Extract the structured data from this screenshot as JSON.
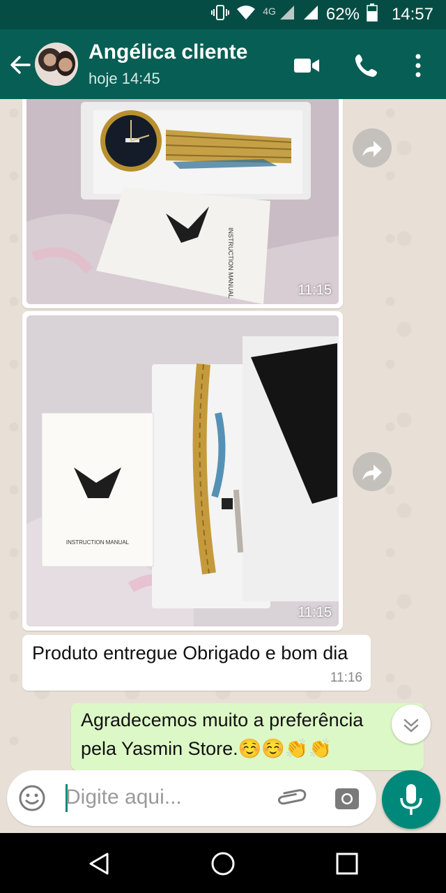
{
  "status_bar": {
    "network": "4G",
    "battery": "62%",
    "time": "14:57"
  },
  "header": {
    "contact_name": "Angélica cliente",
    "last_seen": "hoje 14:45"
  },
  "messages": [
    {
      "type": "image",
      "direction": "incoming",
      "time": "11:15",
      "booklet_text": "INSTRUCTION MANUAL"
    },
    {
      "type": "image",
      "direction": "incoming",
      "time": "11:15",
      "booklet_text": "INSTRUCTION MANUAL"
    },
    {
      "type": "text",
      "direction": "incoming",
      "text": "Produto entregue Obrigado e bom dia",
      "time": "11:16"
    },
    {
      "type": "text",
      "direction": "outgoing",
      "line1": "Agradecemos muito a preferência",
      "line2": "pela Yasmin Store.☺️☺️👏👏"
    }
  ],
  "composer": {
    "placeholder": "Digite aqui..."
  },
  "colors": {
    "header": "#075e54",
    "status_bar": "#054d44",
    "accent": "#00897b",
    "outgoing_bubble": "#dcf8c6"
  },
  "icons": [
    "back-arrow-icon",
    "video-call-icon",
    "phone-icon",
    "more-options-icon",
    "share-icon",
    "emoji-icon",
    "attach-icon",
    "camera-icon",
    "mic-icon",
    "nav-back-icon",
    "nav-home-icon",
    "nav-recents-icon"
  ]
}
